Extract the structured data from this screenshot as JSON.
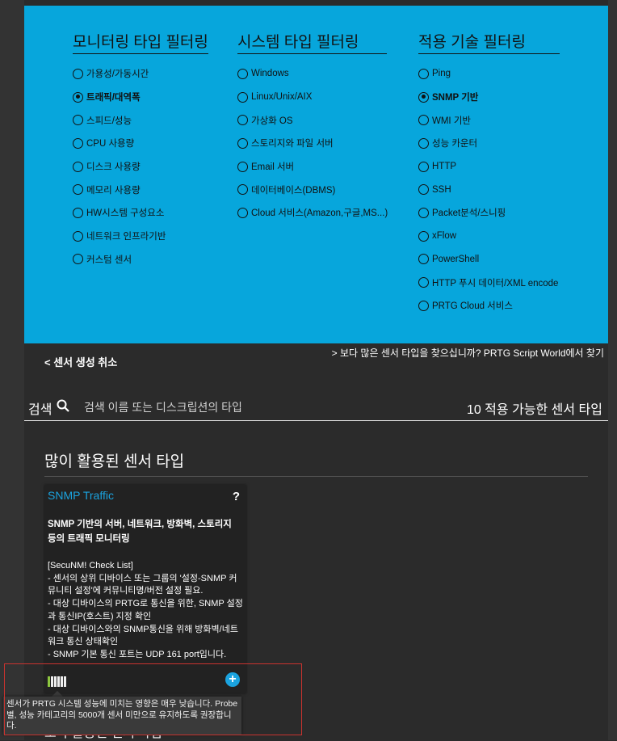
{
  "filters": {
    "monitoring": {
      "title": "모니터링 타입 필터링",
      "options": [
        {
          "label": "가용성/가동시간",
          "selected": false
        },
        {
          "label": "트래픽/대역폭",
          "selected": true
        },
        {
          "label": "스피드/성능",
          "selected": false
        },
        {
          "label": "CPU 사용량",
          "selected": false
        },
        {
          "label": "디스크 사용량",
          "selected": false
        },
        {
          "label": "메모리 사용량",
          "selected": false
        },
        {
          "label": "HW시스템 구성요소",
          "selected": false
        },
        {
          "label": "네트워크 인프라기반",
          "selected": false
        },
        {
          "label": "커스텀 센서",
          "selected": false
        }
      ]
    },
    "system": {
      "title": "시스템 타입 필터링",
      "options": [
        {
          "label": "Windows",
          "selected": false
        },
        {
          "label": "Linux/Unix/AIX",
          "selected": false
        },
        {
          "label": "가상화 OS",
          "selected": false
        },
        {
          "label": "스토리지와 파일 서버",
          "selected": false
        },
        {
          "label": "Email 서버",
          "selected": false
        },
        {
          "label": "데이터베이스(DBMS)",
          "selected": false
        },
        {
          "label": "Cloud 서비스(Amazon,구글,MS...)",
          "selected": false
        }
      ]
    },
    "technology": {
      "title": "적용 기술 필터링",
      "options": [
        {
          "label": "Ping",
          "selected": false
        },
        {
          "label": "SNMP 기반",
          "selected": true
        },
        {
          "label": "WMI 기반",
          "selected": false
        },
        {
          "label": "성능 카운터",
          "selected": false
        },
        {
          "label": "HTTP",
          "selected": false
        },
        {
          "label": "SSH",
          "selected": false
        },
        {
          "label": "Packet분석/스니핑",
          "selected": false
        },
        {
          "label": "xFlow",
          "selected": false
        },
        {
          "label": "PowerShell",
          "selected": false
        },
        {
          "label": "HTTP 푸시 데이터/XML encode",
          "selected": false
        },
        {
          "label": "PRTG Cloud 서비스",
          "selected": false
        }
      ]
    }
  },
  "nav": {
    "cancel": "< 센서 생성 취소",
    "more": "> 보다 많은 센서 타입을 찾으십니까? PRTG Script World에서 찾기"
  },
  "search": {
    "label": "검색",
    "placeholder": "검색 이름 또는 디스크립션의 타입",
    "count": "10 적용 가능한 센서 타입"
  },
  "section": {
    "title": "많이 활용된 센서 타입"
  },
  "card": {
    "title": "SNMP Traffic",
    "help": "?",
    "description": "SNMP 기반의 서버, 네트워크, 방화벽, 스토리지 등의 트래픽 모니터링",
    "checklist": "[SecuNM! Check List]\n- 센서의 상위 디바이스 또는 그룹의 '설정-SNMP 커뮤니티 설정'에 커뮤니티명/버전 설정 필요.\n- 대상 디바이스의 PRTG로 통신을 위한, SNMP 설정과 통신IP(호스트) 지정 확인\n- 대상 디바이스와의 SNMP통신을 위해 방화벽/네트워크 통신 상태확인\n- SNMP 기본 통신 포트는 UDP 161 port입니다.",
    "impact_level": 1,
    "impact_max": 6,
    "add": "+"
  },
  "next_section_partial": "보다 활용된 센서 타입",
  "tooltip": {
    "text": "센서가 PRTG 시스템 성능에 미치는 영향은 매우 낮습니다. Probe 별, 성능 카테고리의 5000개 센서 미만으로 유지하도록 권장합니다."
  },
  "colors": {
    "panel": "#07a6dc",
    "accent": "#1ba3df",
    "impact_low": "#8dc63f",
    "highlight": "#c9332f"
  }
}
